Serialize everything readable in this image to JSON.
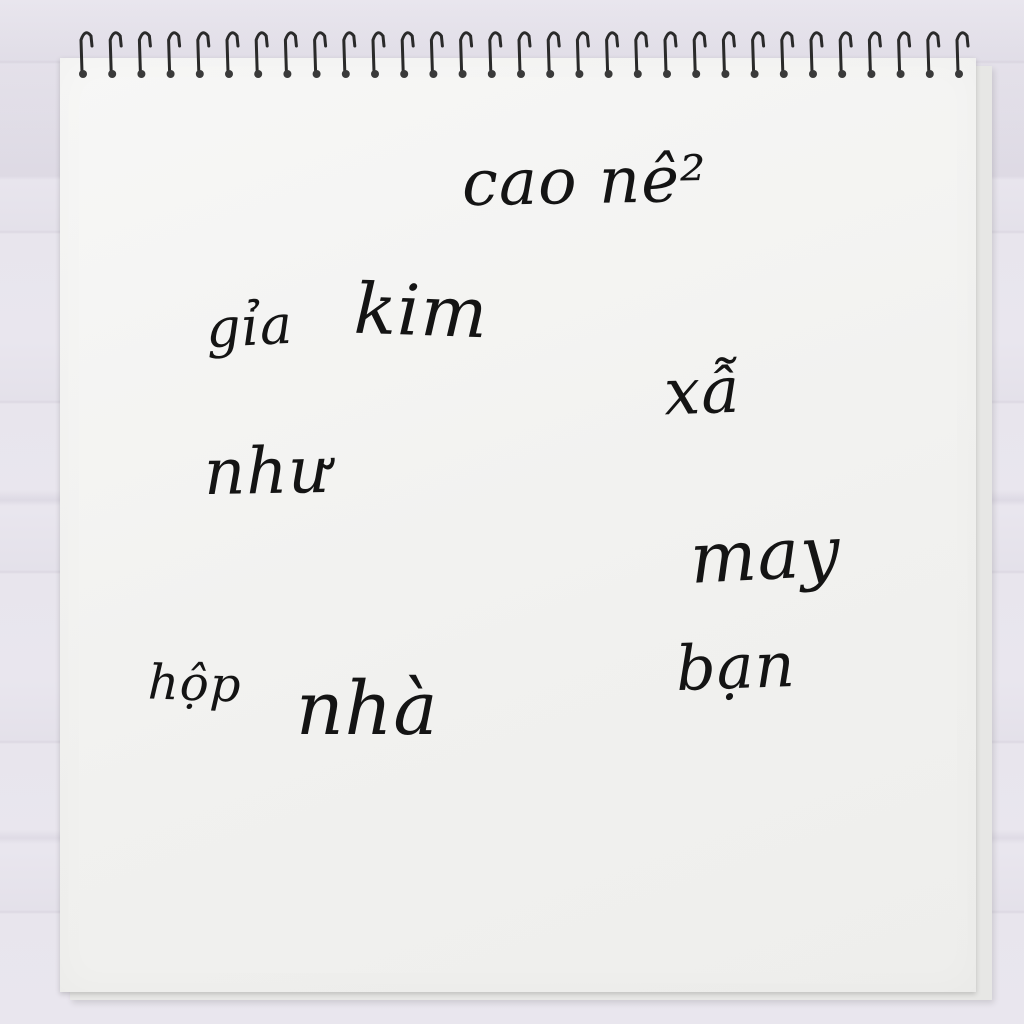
{
  "notepad": {
    "words": [
      {
        "id": "w1",
        "text": "cao nê²"
      },
      {
        "id": "w2",
        "text": "gỉa"
      },
      {
        "id": "w3",
        "text": "kim"
      },
      {
        "id": "w4",
        "text": "xẫ"
      },
      {
        "id": "w5",
        "text": "như"
      },
      {
        "id": "w6",
        "text": "may"
      },
      {
        "id": "w7",
        "text": "hộp"
      },
      {
        "id": "w8",
        "text": "nhà"
      },
      {
        "id": "w9",
        "text": "bạn"
      }
    ]
  },
  "colors": {
    "ink": "#141414",
    "paper": "#f3f3f1",
    "background": "#e6e3eb",
    "spiral": "#222222"
  }
}
